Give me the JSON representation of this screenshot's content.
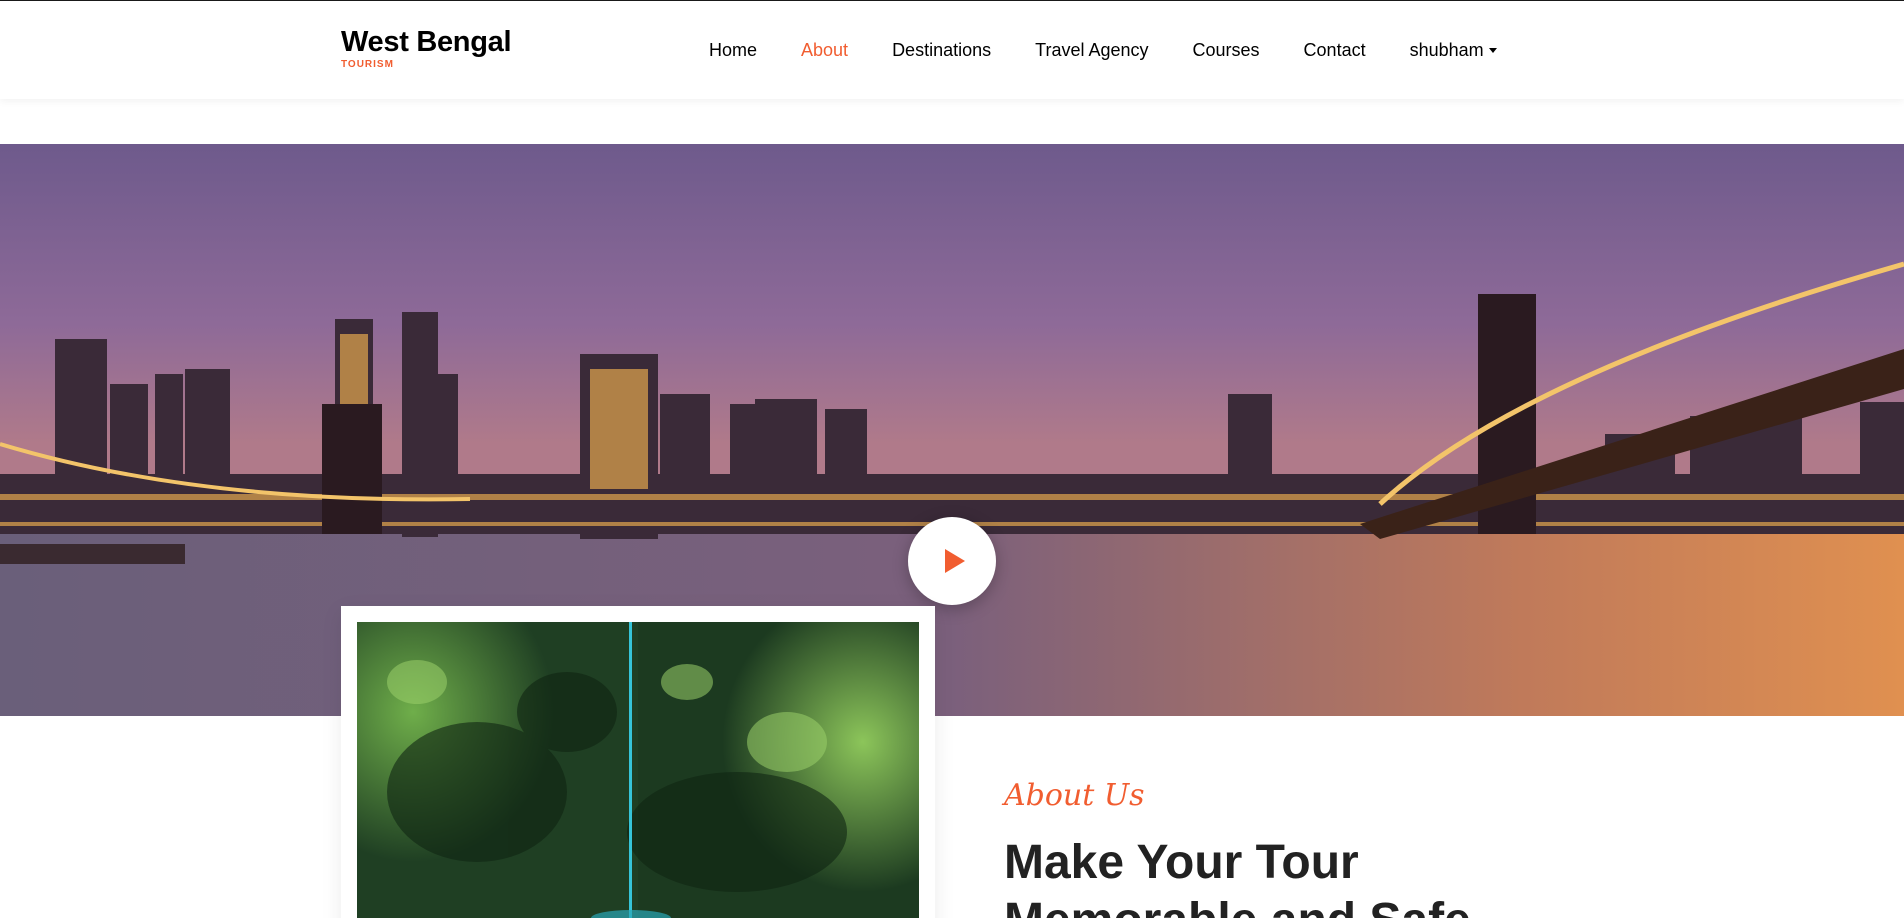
{
  "brand": {
    "title": "West Bengal",
    "subtitle": "TOURISM"
  },
  "nav": {
    "items": [
      {
        "label": "Home",
        "active": false
      },
      {
        "label": "About",
        "active": true
      },
      {
        "label": "Destinations",
        "active": false
      },
      {
        "label": "Travel Agency",
        "active": false
      },
      {
        "label": "Courses",
        "active": false
      },
      {
        "label": "Contact",
        "active": false
      }
    ],
    "user": "shubham"
  },
  "hero": {
    "play_icon": "play-icon"
  },
  "about": {
    "label": "About Us",
    "title": "Make Your Tour Memorable and Safe"
  },
  "colors": {
    "accent": "#f15d30",
    "text": "#000000",
    "heading": "#222222"
  }
}
